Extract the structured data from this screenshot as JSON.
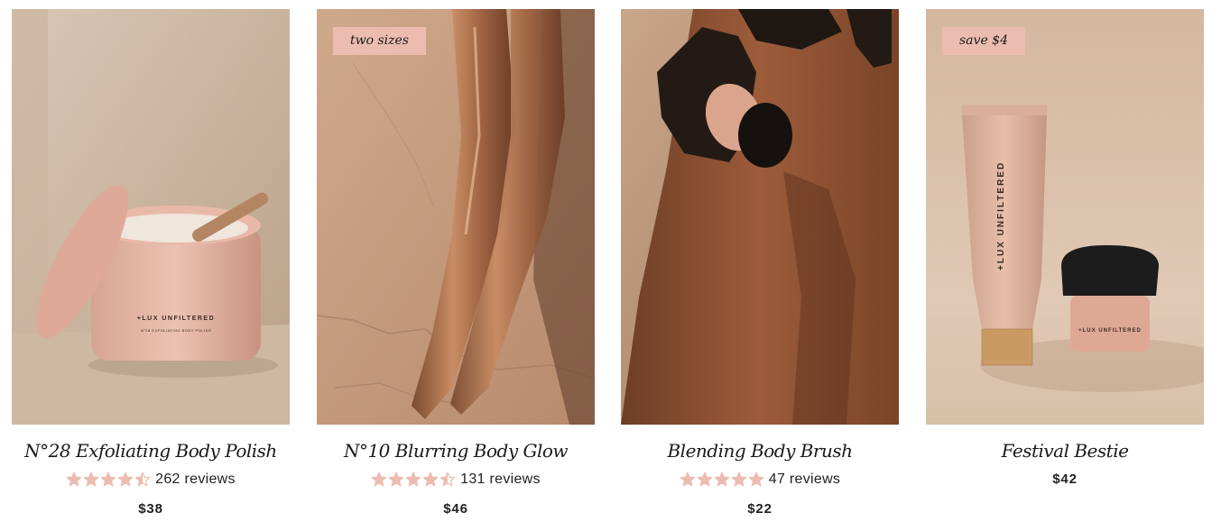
{
  "colors": {
    "star": "#ecbcb0",
    "badge_bg": "#ecbcb0",
    "text": "#1a1a1a"
  },
  "products": [
    {
      "title": "N°28 Exfoliating Body Polish",
      "rating": 4.5,
      "reviews": "262 reviews",
      "price": "$38",
      "badge": "",
      "image": "body-polish-jar-photo"
    },
    {
      "title": "N°10 Blurring Body Glow",
      "rating": 4.5,
      "reviews": "131 reviews",
      "price": "$46",
      "badge": "two sizes",
      "image": "glowing-legs-photo"
    },
    {
      "title": "Blending Body Brush",
      "rating": 5,
      "reviews": "47 reviews",
      "price": "$22",
      "badge": "",
      "image": "body-brush-on-leg-photo"
    },
    {
      "title": "Festival Bestie",
      "rating": null,
      "reviews": "",
      "price": "$42",
      "badge": "save $4",
      "image": "tube-and-brush-photo"
    }
  ],
  "logo_text": {
    "jar": "+LUX UNFILTERED",
    "jar_sub": "N°28 EXFOLIATING BODY POLISH",
    "tube": "+LUX UNFILTERED",
    "brush": "+LUX UNFILTERED"
  }
}
